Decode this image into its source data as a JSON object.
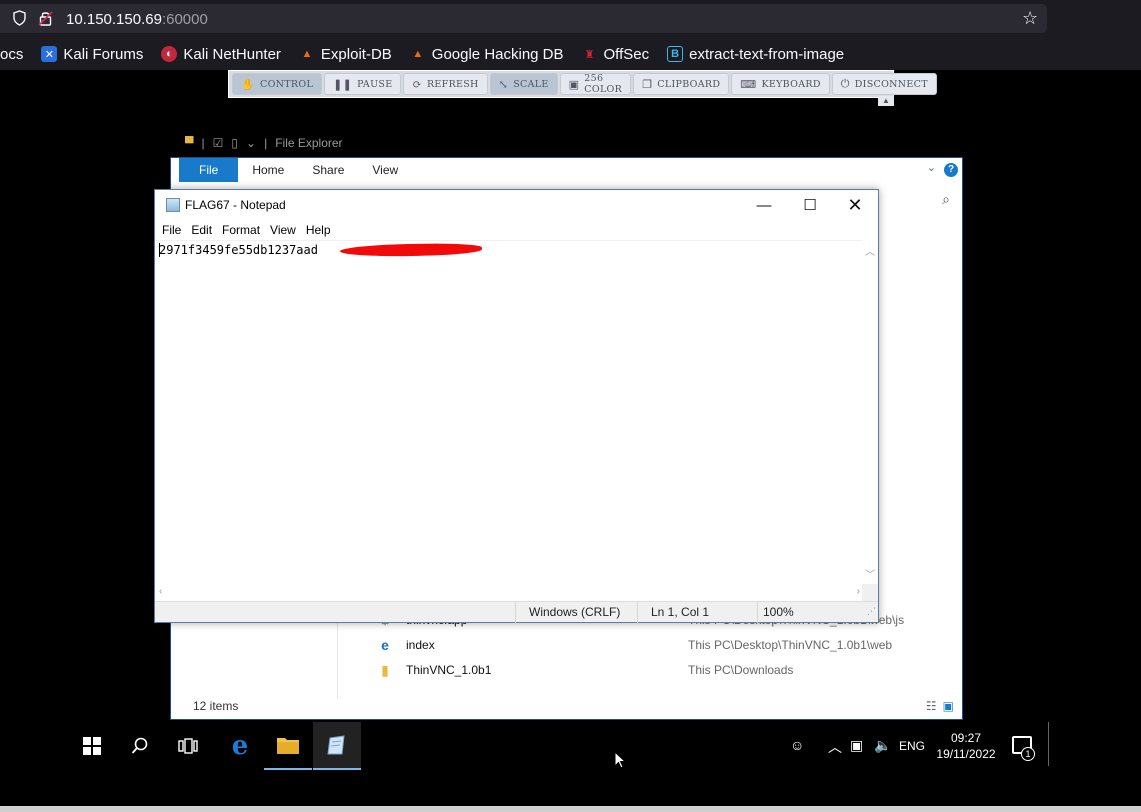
{
  "browser": {
    "url_host": "10.150.150.69",
    "url_port": ":60000",
    "bookmarks": [
      {
        "label": "ocs",
        "icon": "none"
      },
      {
        "label": "Kali Forums",
        "icon": "kali-forums-icon"
      },
      {
        "label": "Kali NetHunter",
        "icon": "nethunter-icon"
      },
      {
        "label": "Exploit-DB",
        "icon": "exploit-db-icon"
      },
      {
        "label": "Google Hacking DB",
        "icon": "ghdb-icon"
      },
      {
        "label": "OffSec",
        "icon": "offsec-icon"
      },
      {
        "label": "extract-text-from-image",
        "icon": "bookmark-b-icon"
      }
    ]
  },
  "vnc_toolbar": {
    "buttons": [
      "CONTROL",
      "PAUSE",
      "REFRESH",
      "SCALE",
      "256 COLOR",
      "CLIPBOARD",
      "KEYBOARD",
      "DISCONNECT"
    ]
  },
  "explorer": {
    "qat_title": "File Explorer",
    "tabs": [
      "File",
      "Home",
      "Share",
      "View"
    ],
    "files": [
      {
        "name": "thinvnc.app",
        "location": "This PC\\Desktop\\ThinVNC_1.0b1\\web\\js"
      },
      {
        "name": "index",
        "location": "This PC\\Desktop\\ThinVNC_1.0b1\\web"
      },
      {
        "name": "ThinVNC_1.0b1",
        "location": "This PC\\Downloads"
      }
    ],
    "status": "12 items"
  },
  "notepad": {
    "title": "FLAG67 - Notepad",
    "menu": [
      "File",
      "Edit",
      "Format",
      "View",
      "Help"
    ],
    "content": "2971f3459fe55db1237aad",
    "status": {
      "line_ending": "Windows (CRLF)",
      "position": "Ln 1, Col 1",
      "zoom": "100%"
    }
  },
  "taskbar": {
    "language": "ENG",
    "time": "09:27",
    "date": "19/11/2022",
    "notification_count": "1"
  },
  "colors": {
    "accent": "#1979ca",
    "redaction": "#f20a0a",
    "browser_bg": "#1c1b22"
  }
}
